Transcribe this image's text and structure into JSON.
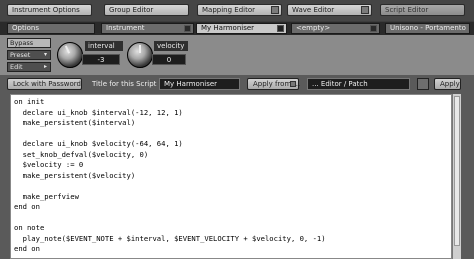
{
  "toolbar": {
    "instrument_options": "Instrument Options",
    "group_editor": "Group Editor",
    "mapping_editor": "Mapping Editor",
    "wave_editor": "Wave Editor",
    "script_editor": "Script Editor"
  },
  "tabs": [
    {
      "label": "Options",
      "selected": false
    },
    {
      "label": "Instrument",
      "selected": false
    },
    {
      "label": "My Harmoniser",
      "selected": true
    },
    {
      "label": "<empty>",
      "selected": false
    },
    {
      "label": "Unisono - Portamento",
      "selected": false
    }
  ],
  "panel": {
    "bypass": "Bypass",
    "preset": "Preset",
    "preset_arrow": "▾",
    "edit": "Edit",
    "edit_arrow": "▸",
    "knobs": [
      {
        "label": "interval",
        "value": "-3"
      },
      {
        "label": "velocity",
        "value": "0"
      }
    ]
  },
  "script_bar": {
    "lock_button": "Lock with Password",
    "title_label": "Title for this Script",
    "title_value": "My Harmoniser",
    "apply_from": "Apply from ...",
    "editor_patch": "... Editor / Patch",
    "apply_button": "Apply"
  },
  "code": [
    "on init",
    "  declare ui_knob $interval(-12, 12, 1)",
    "  make_persistent($interval)",
    "",
    "  declare ui_knob $velocity(-64, 64, 1)",
    "  set_knob_defval($velocity, 0)",
    "  $velocity := 0",
    "  make_persistent($velocity)",
    "",
    "  make_perfview",
    "end on",
    "",
    "on note",
    "  play_note($EVENT_NOTE + $interval, $EVENT_VELOCITY + $velocity, 0, -1)",
    "end on"
  ]
}
